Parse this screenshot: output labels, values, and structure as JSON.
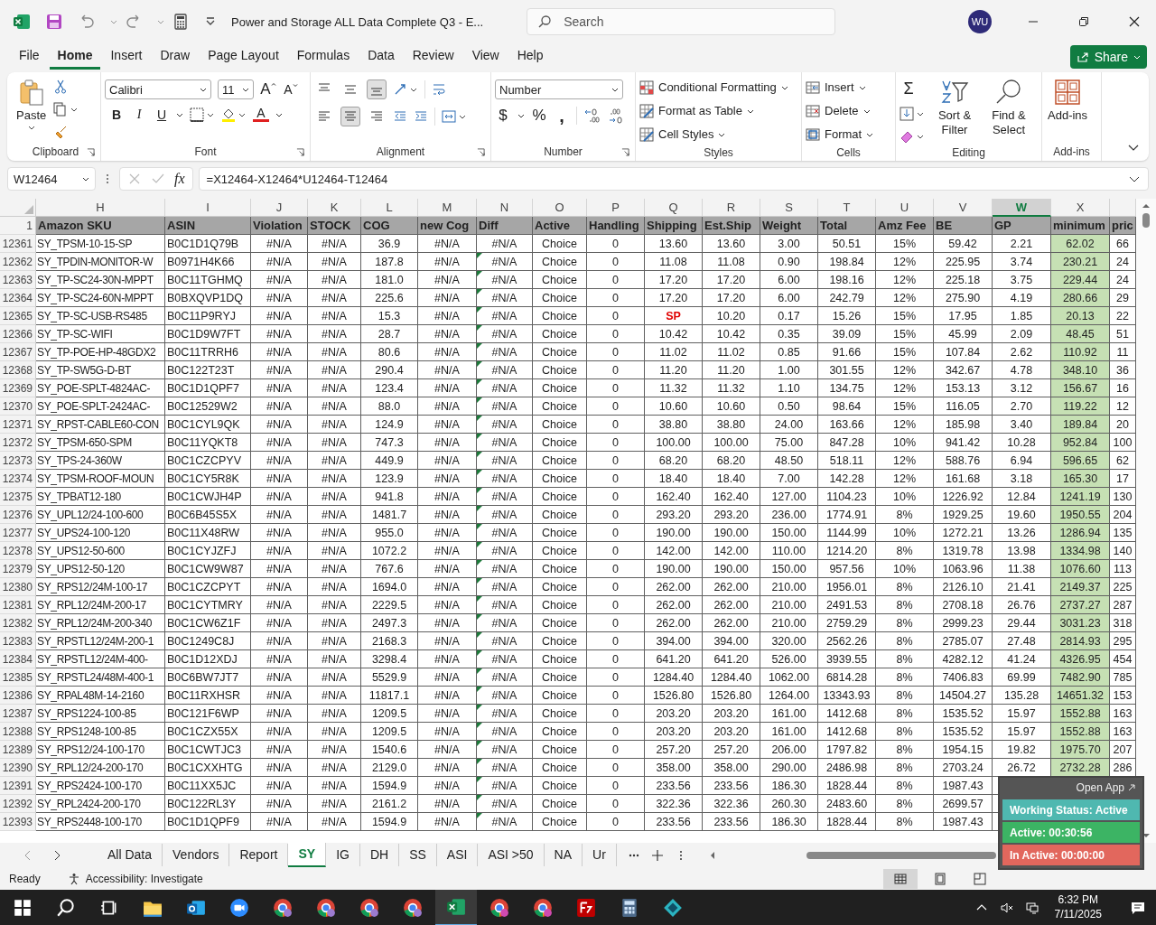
{
  "titlebar": {
    "title": "Power and Storage ALL Data Complete Q3  -  E...",
    "search_placeholder": "Search",
    "avatar": "WU"
  },
  "menu_tabs": [
    {
      "label": "File",
      "selected": false
    },
    {
      "label": "Home",
      "selected": true
    },
    {
      "label": "Insert",
      "selected": false
    },
    {
      "label": "Draw",
      "selected": false
    },
    {
      "label": "Page Layout",
      "selected": false
    },
    {
      "label": "Formulas",
      "selected": false
    },
    {
      "label": "Data",
      "selected": false
    },
    {
      "label": "Review",
      "selected": false
    },
    {
      "label": "View",
      "selected": false
    },
    {
      "label": "Help",
      "selected": false
    }
  ],
  "share": "Share",
  "ribbon": {
    "paste": "Paste",
    "font_name": "Calibri",
    "font_size": "11",
    "grow_font": "A",
    "shrink_font": "A",
    "format_buttons": [
      "B",
      "I",
      "U"
    ],
    "font_color": "A",
    "vertical_align": [
      {
        "selected": false
      },
      {
        "selected": false
      },
      {
        "selected": true
      }
    ],
    "horizontal_align": [
      {
        "selected": false
      },
      {
        "selected": true
      },
      {
        "selected": false
      }
    ],
    "number_format": "Number",
    "currency": "$",
    "percent": "%",
    "comma": ",",
    "styles": [
      "Conditional Formatting",
      "Format as Table",
      "Cell Styles"
    ],
    "cells": [
      "Insert",
      "Delete",
      "Format"
    ],
    "sum": "Σ",
    "sort_filter": "Sort & Filter",
    "find_select": "Find & Select",
    "addins": "Add-ins",
    "groups": [
      "Clipboard",
      "Font",
      "Alignment",
      "Number",
      "Styles",
      "Cells",
      "Editing",
      "Add-ins"
    ]
  },
  "formula_bar": {
    "name_box": "W12464",
    "function_button": "fx",
    "formula": "=X12464-X12464*U12464-T12464"
  },
  "sheet": {
    "header_row": "1",
    "columns": [
      {
        "letter": "H",
        "name": "Amazon SKU",
        "selected": false,
        "highlighted": false
      },
      {
        "letter": "I",
        "name": "ASIN",
        "selected": false,
        "highlighted": false
      },
      {
        "letter": "J",
        "name": "Violation",
        "selected": false,
        "highlighted": false
      },
      {
        "letter": "K",
        "name": "STOCK",
        "selected": false,
        "highlighted": false
      },
      {
        "letter": "L",
        "name": "COG",
        "selected": false,
        "highlighted": false
      },
      {
        "letter": "M",
        "name": "new Cog",
        "selected": false,
        "highlighted": false
      },
      {
        "letter": "N",
        "name": "Diff",
        "selected": false,
        "highlighted": false
      },
      {
        "letter": "O",
        "name": "Active",
        "selected": false,
        "highlighted": false
      },
      {
        "letter": "P",
        "name": "Handling",
        "selected": false,
        "highlighted": false
      },
      {
        "letter": "Q",
        "name": "Shipping",
        "selected": false,
        "highlighted": false
      },
      {
        "letter": "R",
        "name": "Est.Ship",
        "selected": false,
        "highlighted": false
      },
      {
        "letter": "S",
        "name": "Weight",
        "selected": false,
        "highlighted": false
      },
      {
        "letter": "T",
        "name": "Total",
        "selected": false,
        "highlighted": false
      },
      {
        "letter": "U",
        "name": "Amz Fee",
        "selected": false,
        "highlighted": false
      },
      {
        "letter": "V",
        "name": "BE",
        "selected": false,
        "highlighted": false
      },
      {
        "letter": "W",
        "name": "GP",
        "selected": true,
        "highlighted": false
      },
      {
        "letter": "X",
        "name": "minimum",
        "selected": false,
        "highlighted": true
      },
      {
        "name": "pric",
        "selected": false,
        "highlighted": false
      }
    ],
    "rows": [
      {
        "n": "12361",
        "flagged": false,
        "cells": [
          "SY_TPSM-10-15-SP",
          "B0C1D1Q79B",
          "#N/A",
          "#N/A",
          "36.9",
          "#N/A",
          "#N/A",
          "Choice",
          "0",
          "13.60",
          "13.60",
          "3.00",
          "50.51",
          "15%",
          "59.42",
          "2.21",
          "62.02",
          "66"
        ]
      },
      {
        "n": "12362",
        "flagged": true,
        "cells": [
          "SY_TPDIN-MONITOR-W",
          "B0971H4K66",
          "#N/A",
          "#N/A",
          "187.8",
          "#N/A",
          "#N/A",
          "Choice",
          "0",
          "11.08",
          "11.08",
          "0.90",
          "198.84",
          "12%",
          "225.95",
          "3.74",
          "230.21",
          "24"
        ]
      },
      {
        "n": "12363",
        "flagged": true,
        "cells": [
          "SY_TP-SC24-30N-MPPT",
          "B0C11TGHMQ",
          "#N/A",
          "#N/A",
          "181.0",
          "#N/A",
          "#N/A",
          "Choice",
          "0",
          "17.20",
          "17.20",
          "6.00",
          "198.16",
          "12%",
          "225.18",
          "3.75",
          "229.44",
          "24"
        ]
      },
      {
        "n": "12364",
        "flagged": true,
        "cells": [
          "SY_TP-SC24-60N-MPPT",
          "B0BXQVP1DQ",
          "#N/A",
          "#N/A",
          "225.6",
          "#N/A",
          "#N/A",
          "Choice",
          "0",
          "17.20",
          "17.20",
          "6.00",
          "242.79",
          "12%",
          "275.90",
          "4.19",
          "280.66",
          "29"
        ]
      },
      {
        "n": "12365",
        "flagged": true,
        "cells": [
          "SY_TP-SC-USB-RS485",
          "B0C11P9RYJ",
          "#N/A",
          "#N/A",
          "15.3",
          "#N/A",
          "#N/A",
          "Choice",
          "0",
          {
            "text": "SP",
            "kind": "error"
          },
          "10.20",
          "0.17",
          "15.26",
          "15%",
          "17.95",
          "1.85",
          "20.13",
          "22"
        ]
      },
      {
        "n": "12366",
        "flagged": true,
        "cells": [
          "SY_TP-SC-WIFI",
          "B0C1D9W7FT",
          "#N/A",
          "#N/A",
          "28.7",
          "#N/A",
          "#N/A",
          "Choice",
          "0",
          "10.42",
          "10.42",
          "0.35",
          "39.09",
          "15%",
          "45.99",
          "2.09",
          "48.45",
          "51"
        ]
      },
      {
        "n": "12367",
        "flagged": true,
        "cells": [
          "SY_TP-POE-HP-48GDX2",
          "B0C11TRRH6",
          "#N/A",
          "#N/A",
          "80.6",
          "#N/A",
          "#N/A",
          "Choice",
          "0",
          "11.02",
          "11.02",
          "0.85",
          "91.66",
          "15%",
          "107.84",
          "2.62",
          "110.92",
          "11"
        ]
      },
      {
        "n": "12368",
        "flagged": true,
        "cells": [
          "SY_TP-SW5G-D-BT",
          "B0C122T23T",
          "#N/A",
          "#N/A",
          "290.4",
          "#N/A",
          "#N/A",
          "Choice",
          "0",
          "11.20",
          "11.20",
          "1.00",
          "301.55",
          "12%",
          "342.67",
          "4.78",
          "348.10",
          "36"
        ]
      },
      {
        "n": "12369",
        "flagged": true,
        "cells": [
          "SY_POE-SPLT-4824AC-",
          "B0C1D1QPF7",
          "#N/A",
          "#N/A",
          "123.4",
          "#N/A",
          "#N/A",
          "Choice",
          "0",
          "11.32",
          "11.32",
          "1.10",
          "134.75",
          "12%",
          "153.13",
          "3.12",
          "156.67",
          "16"
        ]
      },
      {
        "n": "12370",
        "flagged": true,
        "cells": [
          "SY_POE-SPLT-2424AC-",
          "B0C12529W2",
          "#N/A",
          "#N/A",
          "88.0",
          "#N/A",
          "#N/A",
          "Choice",
          "0",
          "10.60",
          "10.60",
          "0.50",
          "98.64",
          "15%",
          "116.05",
          "2.70",
          "119.22",
          "12"
        ]
      },
      {
        "n": "12371",
        "flagged": true,
        "cells": [
          "SY_RPST-CABLE60-CON",
          "B0C1CYL9QK",
          "#N/A",
          "#N/A",
          "124.9",
          "#N/A",
          "#N/A",
          "Choice",
          "0",
          "38.80",
          "38.80",
          "24.00",
          "163.66",
          "12%",
          "185.98",
          "3.40",
          "189.84",
          "20"
        ]
      },
      {
        "n": "12372",
        "flagged": true,
        "cells": [
          "SY_TPSM-650-SPM",
          "B0C11YQKT8",
          "#N/A",
          "#N/A",
          "747.3",
          "#N/A",
          "#N/A",
          "Choice",
          "0",
          "100.00",
          "100.00",
          "75.00",
          "847.28",
          "10%",
          "941.42",
          "10.28",
          "952.84",
          "100"
        ]
      },
      {
        "n": "12373",
        "flagged": true,
        "cells": [
          "SY_TPS-24-360W",
          "B0C1CZCPYV",
          "#N/A",
          "#N/A",
          "449.9",
          "#N/A",
          "#N/A",
          "Choice",
          "0",
          "68.20",
          "68.20",
          "48.50",
          "518.11",
          "12%",
          "588.76",
          "6.94",
          "596.65",
          "62"
        ]
      },
      {
        "n": "12374",
        "flagged": true,
        "cells": [
          "SY_TPSM-ROOF-MOUN",
          "B0C1CY5R8K",
          "#N/A",
          "#N/A",
          "123.9",
          "#N/A",
          "#N/A",
          "Choice",
          "0",
          "18.40",
          "18.40",
          "7.00",
          "142.28",
          "12%",
          "161.68",
          "3.18",
          "165.30",
          "17"
        ]
      },
      {
        "n": "12375",
        "flagged": true,
        "cells": [
          "SY_TPBAT12-180",
          "B0C1CWJH4P",
          "#N/A",
          "#N/A",
          "941.8",
          "#N/A",
          "#N/A",
          "Choice",
          "0",
          "162.40",
          "162.40",
          "127.00",
          "1104.23",
          "10%",
          "1226.92",
          "12.84",
          "1241.19",
          "130"
        ]
      },
      {
        "n": "12376",
        "flagged": true,
        "cells": [
          "SY_UPL12/24-100-600",
          "B0C6B45S5X",
          "#N/A",
          "#N/A",
          "1481.7",
          "#N/A",
          "#N/A",
          "Choice",
          "0",
          "293.20",
          "293.20",
          "236.00",
          "1774.91",
          "8%",
          "1929.25",
          "19.60",
          "1950.55",
          "204"
        ]
      },
      {
        "n": "12377",
        "flagged": true,
        "cells": [
          "SY_UPS24-100-120",
          "B0C11X48RW",
          "#N/A",
          "#N/A",
          "955.0",
          "#N/A",
          "#N/A",
          "Choice",
          "0",
          "190.00",
          "190.00",
          "150.00",
          "1144.99",
          "10%",
          "1272.21",
          "13.26",
          "1286.94",
          "135"
        ]
      },
      {
        "n": "12378",
        "flagged": true,
        "cells": [
          "SY_UPS12-50-600",
          "B0C1CYJZFJ",
          "#N/A",
          "#N/A",
          "1072.2",
          "#N/A",
          "#N/A",
          "Choice",
          "0",
          "142.00",
          "142.00",
          "110.00",
          "1214.20",
          "8%",
          "1319.78",
          "13.98",
          "1334.98",
          "140"
        ]
      },
      {
        "n": "12379",
        "flagged": true,
        "cells": [
          "SY_UPS12-50-120",
          "B0C1CW9W87",
          "#N/A",
          "#N/A",
          "767.6",
          "#N/A",
          "#N/A",
          "Choice",
          "0",
          "190.00",
          "190.00",
          "150.00",
          "957.56",
          "10%",
          "1063.96",
          "11.38",
          "1076.60",
          "113"
        ]
      },
      {
        "n": "12380",
        "flagged": true,
        "cells": [
          "SY_RPS12/24M-100-17",
          "B0C1CZCPYT",
          "#N/A",
          "#N/A",
          "1694.0",
          "#N/A",
          "#N/A",
          "Choice",
          "0",
          "262.00",
          "262.00",
          "210.00",
          "1956.01",
          "8%",
          "2126.10",
          "21.41",
          "2149.37",
          "225"
        ]
      },
      {
        "n": "12381",
        "flagged": true,
        "cells": [
          "SY_RPL12/24M-200-17",
          "B0C1CYTMRY",
          "#N/A",
          "#N/A",
          "2229.5",
          "#N/A",
          "#N/A",
          "Choice",
          "0",
          "262.00",
          "262.00",
          "210.00",
          "2491.53",
          "8%",
          "2708.18",
          "26.76",
          "2737.27",
          "287"
        ]
      },
      {
        "n": "12382",
        "flagged": true,
        "cells": [
          "SY_RPL12/24M-200-340",
          "B0C1CW6Z1F",
          "#N/A",
          "#N/A",
          "2497.3",
          "#N/A",
          "#N/A",
          "Choice",
          "0",
          "262.00",
          "262.00",
          "210.00",
          "2759.29",
          "8%",
          "2999.23",
          "29.44",
          "3031.23",
          "318"
        ]
      },
      {
        "n": "12383",
        "flagged": true,
        "cells": [
          "SY_RPSTL12/24M-200-1",
          "B0C1249C8J",
          "#N/A",
          "#N/A",
          "2168.3",
          "#N/A",
          "#N/A",
          "Choice",
          "0",
          "394.00",
          "394.00",
          "320.00",
          "2562.26",
          "8%",
          "2785.07",
          "27.48",
          "2814.93",
          "295"
        ]
      },
      {
        "n": "12384",
        "flagged": true,
        "cells": [
          "SY_RPSTL12/24M-400-",
          "B0C1D12XDJ",
          "#N/A",
          "#N/A",
          "3298.4",
          "#N/A",
          "#N/A",
          "Choice",
          "0",
          "641.20",
          "641.20",
          "526.00",
          "3939.55",
          "8%",
          "4282.12",
          "41.24",
          "4326.95",
          "454"
        ]
      },
      {
        "n": "12385",
        "flagged": true,
        "cells": [
          "SY_RPSTL24/48M-400-1",
          "B0C6BW7JT7",
          "#N/A",
          "#N/A",
          "5529.9",
          "#N/A",
          "#N/A",
          "Choice",
          "0",
          "1284.40",
          "1284.40",
          "1062.00",
          "6814.28",
          "8%",
          "7406.83",
          "69.99",
          "7482.90",
          "785"
        ]
      },
      {
        "n": "12386",
        "flagged": true,
        "cells": [
          "SY_RPAL48M-14-2160",
          "B0C11RXHSR",
          "#N/A",
          "#N/A",
          "11817.1",
          "#N/A",
          "#N/A",
          "Choice",
          "0",
          "1526.80",
          "1526.80",
          "1264.00",
          "13343.93",
          "8%",
          "14504.27",
          "135.28",
          "14651.32",
          "153"
        ]
      },
      {
        "n": "12387",
        "flagged": true,
        "cells": [
          "SY_RPS1224-100-85",
          "B0C121F6WP",
          "#N/A",
          "#N/A",
          "1209.5",
          "#N/A",
          "#N/A",
          "Choice",
          "0",
          "203.20",
          "203.20",
          "161.00",
          "1412.68",
          "8%",
          "1535.52",
          "15.97",
          "1552.88",
          "163"
        ]
      },
      {
        "n": "12388",
        "flagged": true,
        "cells": [
          "SY_RPS1248-100-85",
          "B0C1CZX55X",
          "#N/A",
          "#N/A",
          "1209.5",
          "#N/A",
          "#N/A",
          "Choice",
          "0",
          "203.20",
          "203.20",
          "161.00",
          "1412.68",
          "8%",
          "1535.52",
          "15.97",
          "1552.88",
          "163"
        ]
      },
      {
        "n": "12389",
        "flagged": true,
        "cells": [
          "SY_RPS12/24-100-170",
          "B0C1CWTJC3",
          "#N/A",
          "#N/A",
          "1540.6",
          "#N/A",
          "#N/A",
          "Choice",
          "0",
          "257.20",
          "257.20",
          "206.00",
          "1797.82",
          "8%",
          "1954.15",
          "19.82",
          "1975.70",
          "207"
        ]
      },
      {
        "n": "12390",
        "flagged": true,
        "cells": [
          "SY_RPL12/24-200-170",
          "B0C1CXXHTG",
          "#N/A",
          "#N/A",
          "2129.0",
          "#N/A",
          "#N/A",
          "Choice",
          "0",
          "358.00",
          "358.00",
          "290.00",
          "2486.98",
          "8%",
          "2703.24",
          "26.72",
          "2732.28",
          "286"
        ]
      },
      {
        "n": "12391",
        "flagged": true,
        "cells": [
          "SY_RPS2424-100-170",
          "B0C11XX5JC",
          "#N/A",
          "#N/A",
          "1594.9",
          "#N/A",
          "#N/A",
          "Choice",
          "0",
          "233.56",
          "233.56",
          "186.30",
          "1828.44",
          "8%",
          "1987.43"
        ]
      },
      {
        "n": "12392",
        "flagged": true,
        "cells": [
          "SY_RPL2424-200-170",
          "B0C122RL3Y",
          "#N/A",
          "#N/A",
          "2161.2",
          "#N/A",
          "#N/A",
          "Choice",
          "0",
          "322.36",
          "322.36",
          "260.30",
          "2483.60",
          "8%",
          "2699.57"
        ]
      },
      {
        "n": "12393",
        "flagged": true,
        "cells": [
          "SY_RPS2448-100-170",
          "B0C1D1QPF9",
          "#N/A",
          "#N/A",
          "1594.9",
          "#N/A",
          "#N/A",
          "Choice",
          "0",
          "233.56",
          "233.56",
          "186.30",
          "1828.44",
          "8%",
          "1987.43"
        ]
      }
    ]
  },
  "sheet_tabs": [
    {
      "label": "All Data",
      "selected": false
    },
    {
      "label": "Vendors",
      "selected": false
    },
    {
      "label": "Report",
      "selected": false
    },
    {
      "label": "SY",
      "selected": true
    },
    {
      "label": "IG",
      "selected": false
    },
    {
      "label": "DH",
      "selected": false
    },
    {
      "label": "SS",
      "selected": false
    },
    {
      "label": "ASI",
      "selected": false
    },
    {
      "label": "ASI >50",
      "selected": false
    },
    {
      "label": "NA",
      "selected": false
    },
    {
      "label": "Ur",
      "selected": false
    }
  ],
  "status_bar": {
    "mode": "Ready",
    "accessibility": "Accessibility: Investigate"
  },
  "popup": {
    "header": "Open App",
    "status": "Working Status: Active",
    "active": "Active: 00:30:56",
    "inactive": "In Active: 00:00:00"
  },
  "taskbar": {
    "time": "6:32 PM",
    "date": "7/11/2025"
  }
}
